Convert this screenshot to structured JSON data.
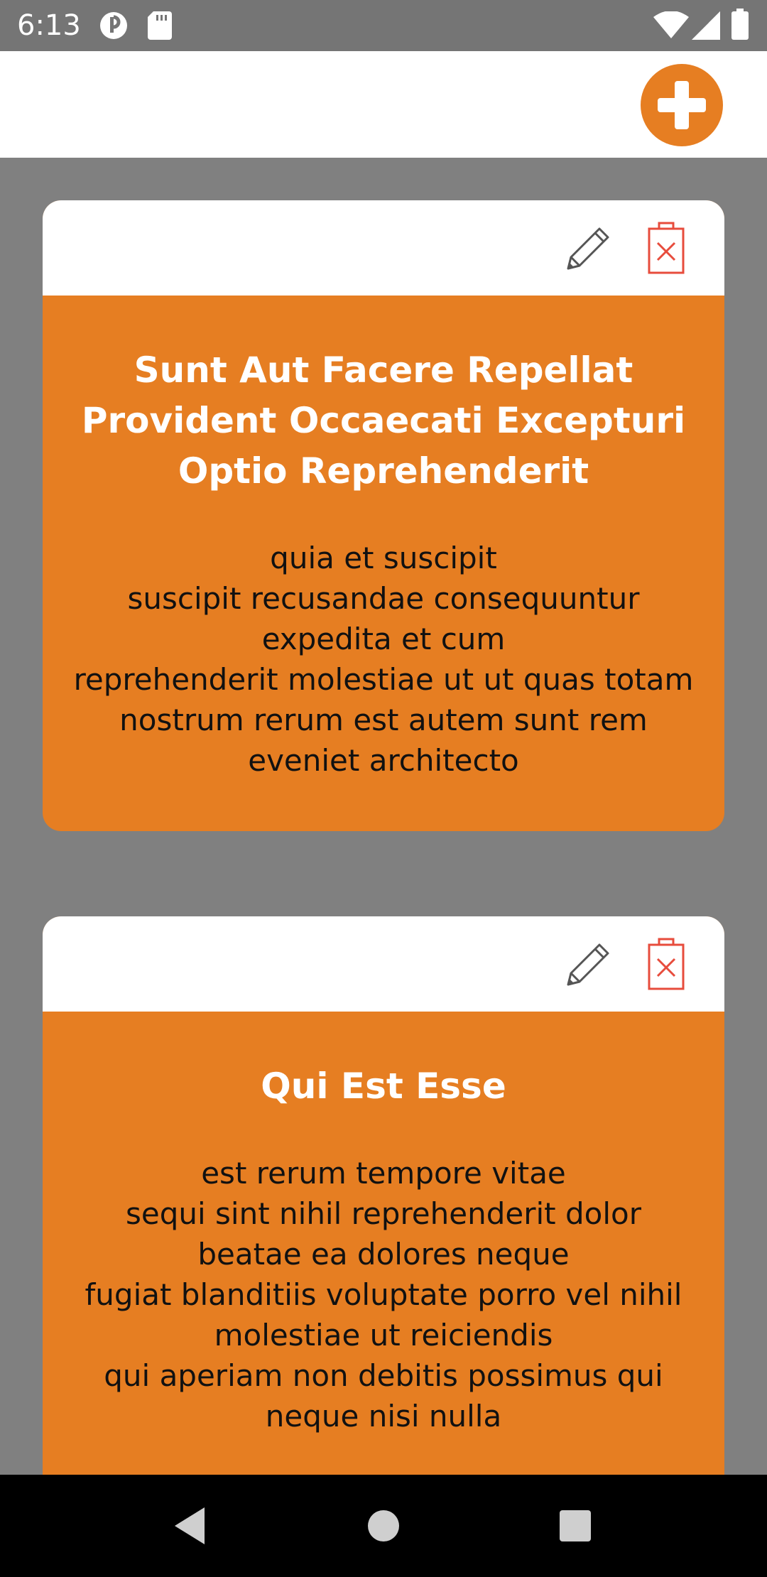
{
  "status_bar": {
    "time": "6:13",
    "icons": [
      "app-icon",
      "sd-card-icon",
      "wifi-icon",
      "signal-icon",
      "battery-icon"
    ]
  },
  "app_bar": {
    "add_button_icon": "plus-icon",
    "accent_color": "#e67e22"
  },
  "posts": [
    {
      "title": "Sunt Aut Facere Repellat Provident Occaecati Excepturi Optio Reprehenderit",
      "body": "quia et suscipit\nsuscipit recusandae consequuntur expedita et cum\nreprehenderit molestiae ut ut quas totam\nnostrum rerum est autem sunt rem eveniet architecto",
      "edit_icon": "pencil-icon",
      "delete_icon": "delete-icon"
    },
    {
      "title": "Qui Est Esse",
      "body": "est rerum tempore vitae\nsequi sint nihil reprehenderit dolor beatae ea dolores neque\nfugiat blanditiis voluptate porro vel nihil molestiae ut reiciendis\nqui aperiam non debitis possimus qui neque nisi nulla",
      "edit_icon": "pencil-icon",
      "delete_icon": "delete-icon"
    }
  ],
  "nav_bar": {
    "icons": [
      "back-icon",
      "home-icon",
      "recents-icon"
    ]
  }
}
